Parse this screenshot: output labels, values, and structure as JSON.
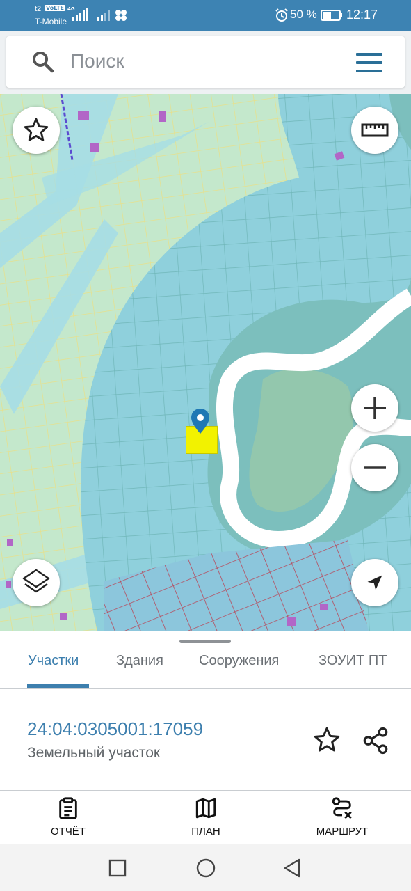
{
  "status_bar": {
    "carrier_top": "t2",
    "volte": "VoLTE",
    "network": "4G",
    "carrier": "T-Mobile",
    "battery_percent": "50 %",
    "time": "12:17",
    "icons": [
      "signal-icon",
      "signal-icon",
      "social-app-icon",
      "alarm-icon",
      "battery-icon"
    ]
  },
  "search": {
    "placeholder": "Поиск",
    "icon": "search-icon",
    "menu_icon": "hamburger-menu-icon"
  },
  "map": {
    "controls": [
      "favorite-star-icon",
      "ruler-icon",
      "zoom-in-icon",
      "zoom-out-icon",
      "layers-icon",
      "navigation-arrow-icon"
    ],
    "marker": "location-pin-icon",
    "colors": {
      "water": "#86cbd8",
      "land": "#bfe6c7",
      "river": "#ffffff",
      "accent": "#1f78b4",
      "selection": "#f5f500",
      "building": "#b266c7"
    }
  },
  "tabs": {
    "items": [
      "Участки",
      "Здания",
      "Сооружения",
      "ЗОУИТ ПТ"
    ],
    "active": "Участки"
  },
  "parcel": {
    "cadastral_number": "24:04:0305001:17059",
    "type": "Земельный участок"
  },
  "actions": {
    "report": "ОТЧЁТ",
    "plan": "ПЛАН",
    "route": "МАРШРУТ"
  },
  "nav": {
    "icons": [
      "recent-apps-icon",
      "home-icon",
      "back-icon"
    ]
  }
}
